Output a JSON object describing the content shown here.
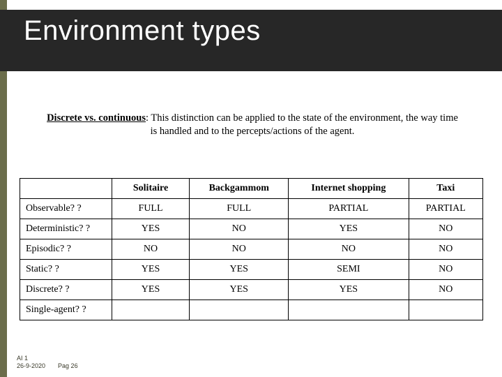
{
  "title": "Environment types",
  "paragraph": {
    "lead": "Discrete vs. continuous",
    "rest": ": This distinction can be applied to the state of the environment, the way time is handled and to the percepts/actions of the agent."
  },
  "table": {
    "columns": [
      "Solitaire",
      "Backgammom",
      "Internet shopping",
      "Taxi"
    ],
    "rows": [
      {
        "label": "Observable? ?",
        "cells": [
          "FULL",
          "FULL",
          "PARTIAL",
          "PARTIAL"
        ]
      },
      {
        "label": "Deterministic? ?",
        "cells": [
          "YES",
          "NO",
          "YES",
          "NO"
        ]
      },
      {
        "label": "Episodic? ?",
        "cells": [
          "NO",
          "NO",
          "NO",
          "NO"
        ]
      },
      {
        "label": "Static? ?",
        "cells": [
          "YES",
          "YES",
          "SEMI",
          "NO"
        ]
      },
      {
        "label": "Discrete? ?",
        "cells": [
          "YES",
          "YES",
          "YES",
          "NO"
        ]
      },
      {
        "label": "Single-agent? ?",
        "cells": [
          "",
          "",
          "",
          ""
        ]
      }
    ]
  },
  "footer": {
    "course": "AI 1",
    "date": "26-9-2020",
    "page": "Pag 26"
  },
  "chart_data": {
    "type": "table",
    "title": "Environment types",
    "columns": [
      "",
      "Solitaire",
      "Backgammom",
      "Internet shopping",
      "Taxi"
    ],
    "rows": [
      [
        "Observable? ?",
        "FULL",
        "FULL",
        "PARTIAL",
        "PARTIAL"
      ],
      [
        "Deterministic? ?",
        "YES",
        "NO",
        "YES",
        "NO"
      ],
      [
        "Episodic? ?",
        "NO",
        "NO",
        "NO",
        "NO"
      ],
      [
        "Static? ?",
        "YES",
        "YES",
        "SEMI",
        "NO"
      ],
      [
        "Discrete? ?",
        "YES",
        "YES",
        "YES",
        "NO"
      ],
      [
        "Single-agent? ?",
        "",
        "",
        "",
        ""
      ]
    ]
  }
}
